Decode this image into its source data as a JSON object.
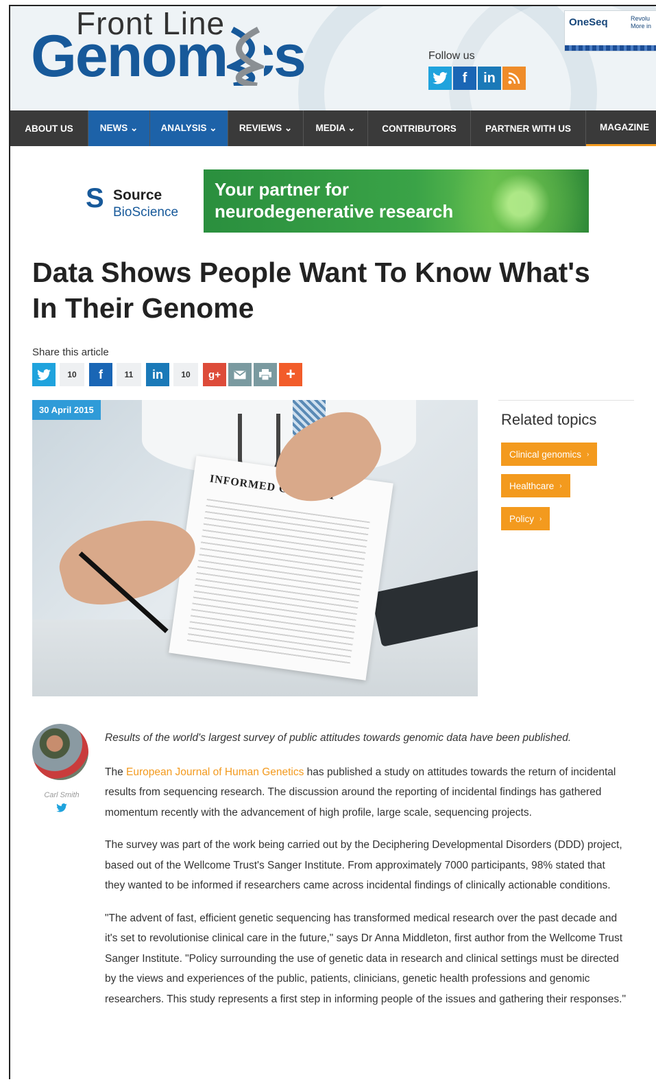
{
  "header": {
    "logo_top": "Front Line",
    "logo_main": "Genomics",
    "follow_label": "Follow us",
    "social": [
      "twitter-icon",
      "facebook-icon",
      "linkedin-icon",
      "rss-icon"
    ],
    "ad_oneseq": {
      "logo": "OneSeq",
      "side_line1": "Revolu",
      "side_line2": "More in"
    }
  },
  "nav": {
    "items": [
      {
        "label": "ABOUT US"
      },
      {
        "label": "NEWS ⌄"
      },
      {
        "label": "ANALYSIS ⌄"
      },
      {
        "label": "REVIEWS ⌄"
      },
      {
        "label": "MEDIA ⌄"
      },
      {
        "label": "CONTRIBUTORS"
      },
      {
        "label": "PARTNER WITH US"
      },
      {
        "label": "MAGAZINE"
      }
    ]
  },
  "banner": {
    "logo_line1": "Source",
    "logo_line2": "BioScience",
    "ad_line1": "Your partner for",
    "ad_line2": "neurodegenerative research"
  },
  "article": {
    "title": "Data Shows People Want To Know What's In Their Genome",
    "share_label": "Share this article",
    "share_counts": {
      "twitter": "10",
      "facebook": "11",
      "linkedin": "10"
    },
    "date": "30 April 2015",
    "image_text": "INFORMED CONSENT",
    "lead": "Results of the world's largest survey of public attitudes towards genomic data have been published.",
    "para1_pre": "The ",
    "para1_link": "European Journal of Human Genetics",
    "para1_post": " has published a study on attitudes towards the return of incidental results from sequencing research. The discussion around the reporting of incidental findings has gathered momentum recently with the advancement of high profile, large scale, sequencing projects.",
    "para2": "The survey was part of the work being carried out by the Deciphering Developmental Disorders (DDD) project, based out of the Wellcome Trust's Sanger Institute. From approximately 7000 participants, 98% stated that they wanted to be informed if researchers came across incidental findings of clinically actionable conditions.",
    "para3": "\"The advent of fast, efficient genetic sequencing has transformed medical research over the past decade and it's set to revolutionise clinical care in the future,\" says Dr Anna Middleton, first author from the Wellcome Trust Sanger Institute. \"Policy surrounding the use of genetic data in research and clinical settings must be directed by the views and experiences of the public, patients, clinicians, genetic health professions and genomic researchers. This study represents a first step in informing people of the issues and gathering their responses.\""
  },
  "author": {
    "name": "Carl Smith"
  },
  "related": {
    "title": "Related topics",
    "tags": [
      "Clinical genomics",
      "Healthcare",
      "Policy"
    ]
  },
  "colors": {
    "brand_blue": "#17599a",
    "accent_orange": "#f39a1e",
    "nav_dark": "#3a3a3a"
  }
}
